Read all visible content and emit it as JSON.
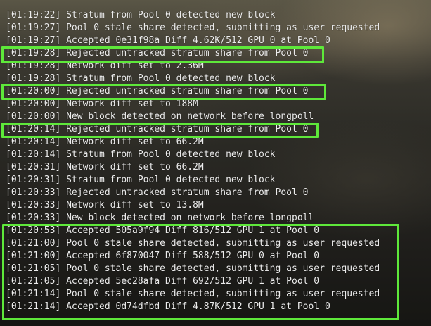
{
  "log_lines": [
    "[01:19:22] Stratum from Pool 0 detected new block",
    "[01:19:27] Pool 0 stale share detected, submitting as user requested",
    "[01:19:27] Accepted 0e31f98a Diff 4.62K/512 GPU 0 at Pool 0",
    "[01:19:28] Rejected untracked stratum share from Pool 0",
    "[01:19:28] Network diff set to 2.36M",
    "[01:19:28] Stratum from Pool 0 detected new block",
    "[01:20:00] Rejected untracked stratum share from Pool 0",
    "[01:20:00] Network diff set to 188M",
    "[01:20:00] New block detected on network before longpoll",
    "[01:20:14] Rejected untracked stratum share from Pool 0",
    "[01:20:14] Network diff set to 66.2M",
    "[01:20:14] Stratum from Pool 0 detected new block",
    "[01:20:31] Network diff set to 66.2M",
    "[01:20:31] Stratum from Pool 0 detected new block",
    "[01:20:33] Rejected untracked stratum share from Pool 0",
    "[01:20:33] Network diff set to 13.8M",
    "[01:20:33] New block detected on network before longpoll",
    "[01:20:53] Accepted 505a9f94 Diff 816/512 GPU 1 at Pool 0",
    "[01:21:00] Pool 0 stale share detected, submitting as user requested",
    "[01:21:00] Accepted 6f870047 Diff 588/512 GPU 0 at Pool 0",
    "[01:21:05] Pool 0 stale share detected, submitting as user requested",
    "[01:21:05] Accepted 5ec28afa Diff 692/512 GPU 1 at Pool 0",
    "[01:21:14] Pool 0 stale share detected, submitting as user requested",
    "[01:21:14] Accepted 0d74dfbd Diff 4.87K/512 GPU 1 at Pool 0"
  ],
  "highlight_color": "#5ee83a"
}
